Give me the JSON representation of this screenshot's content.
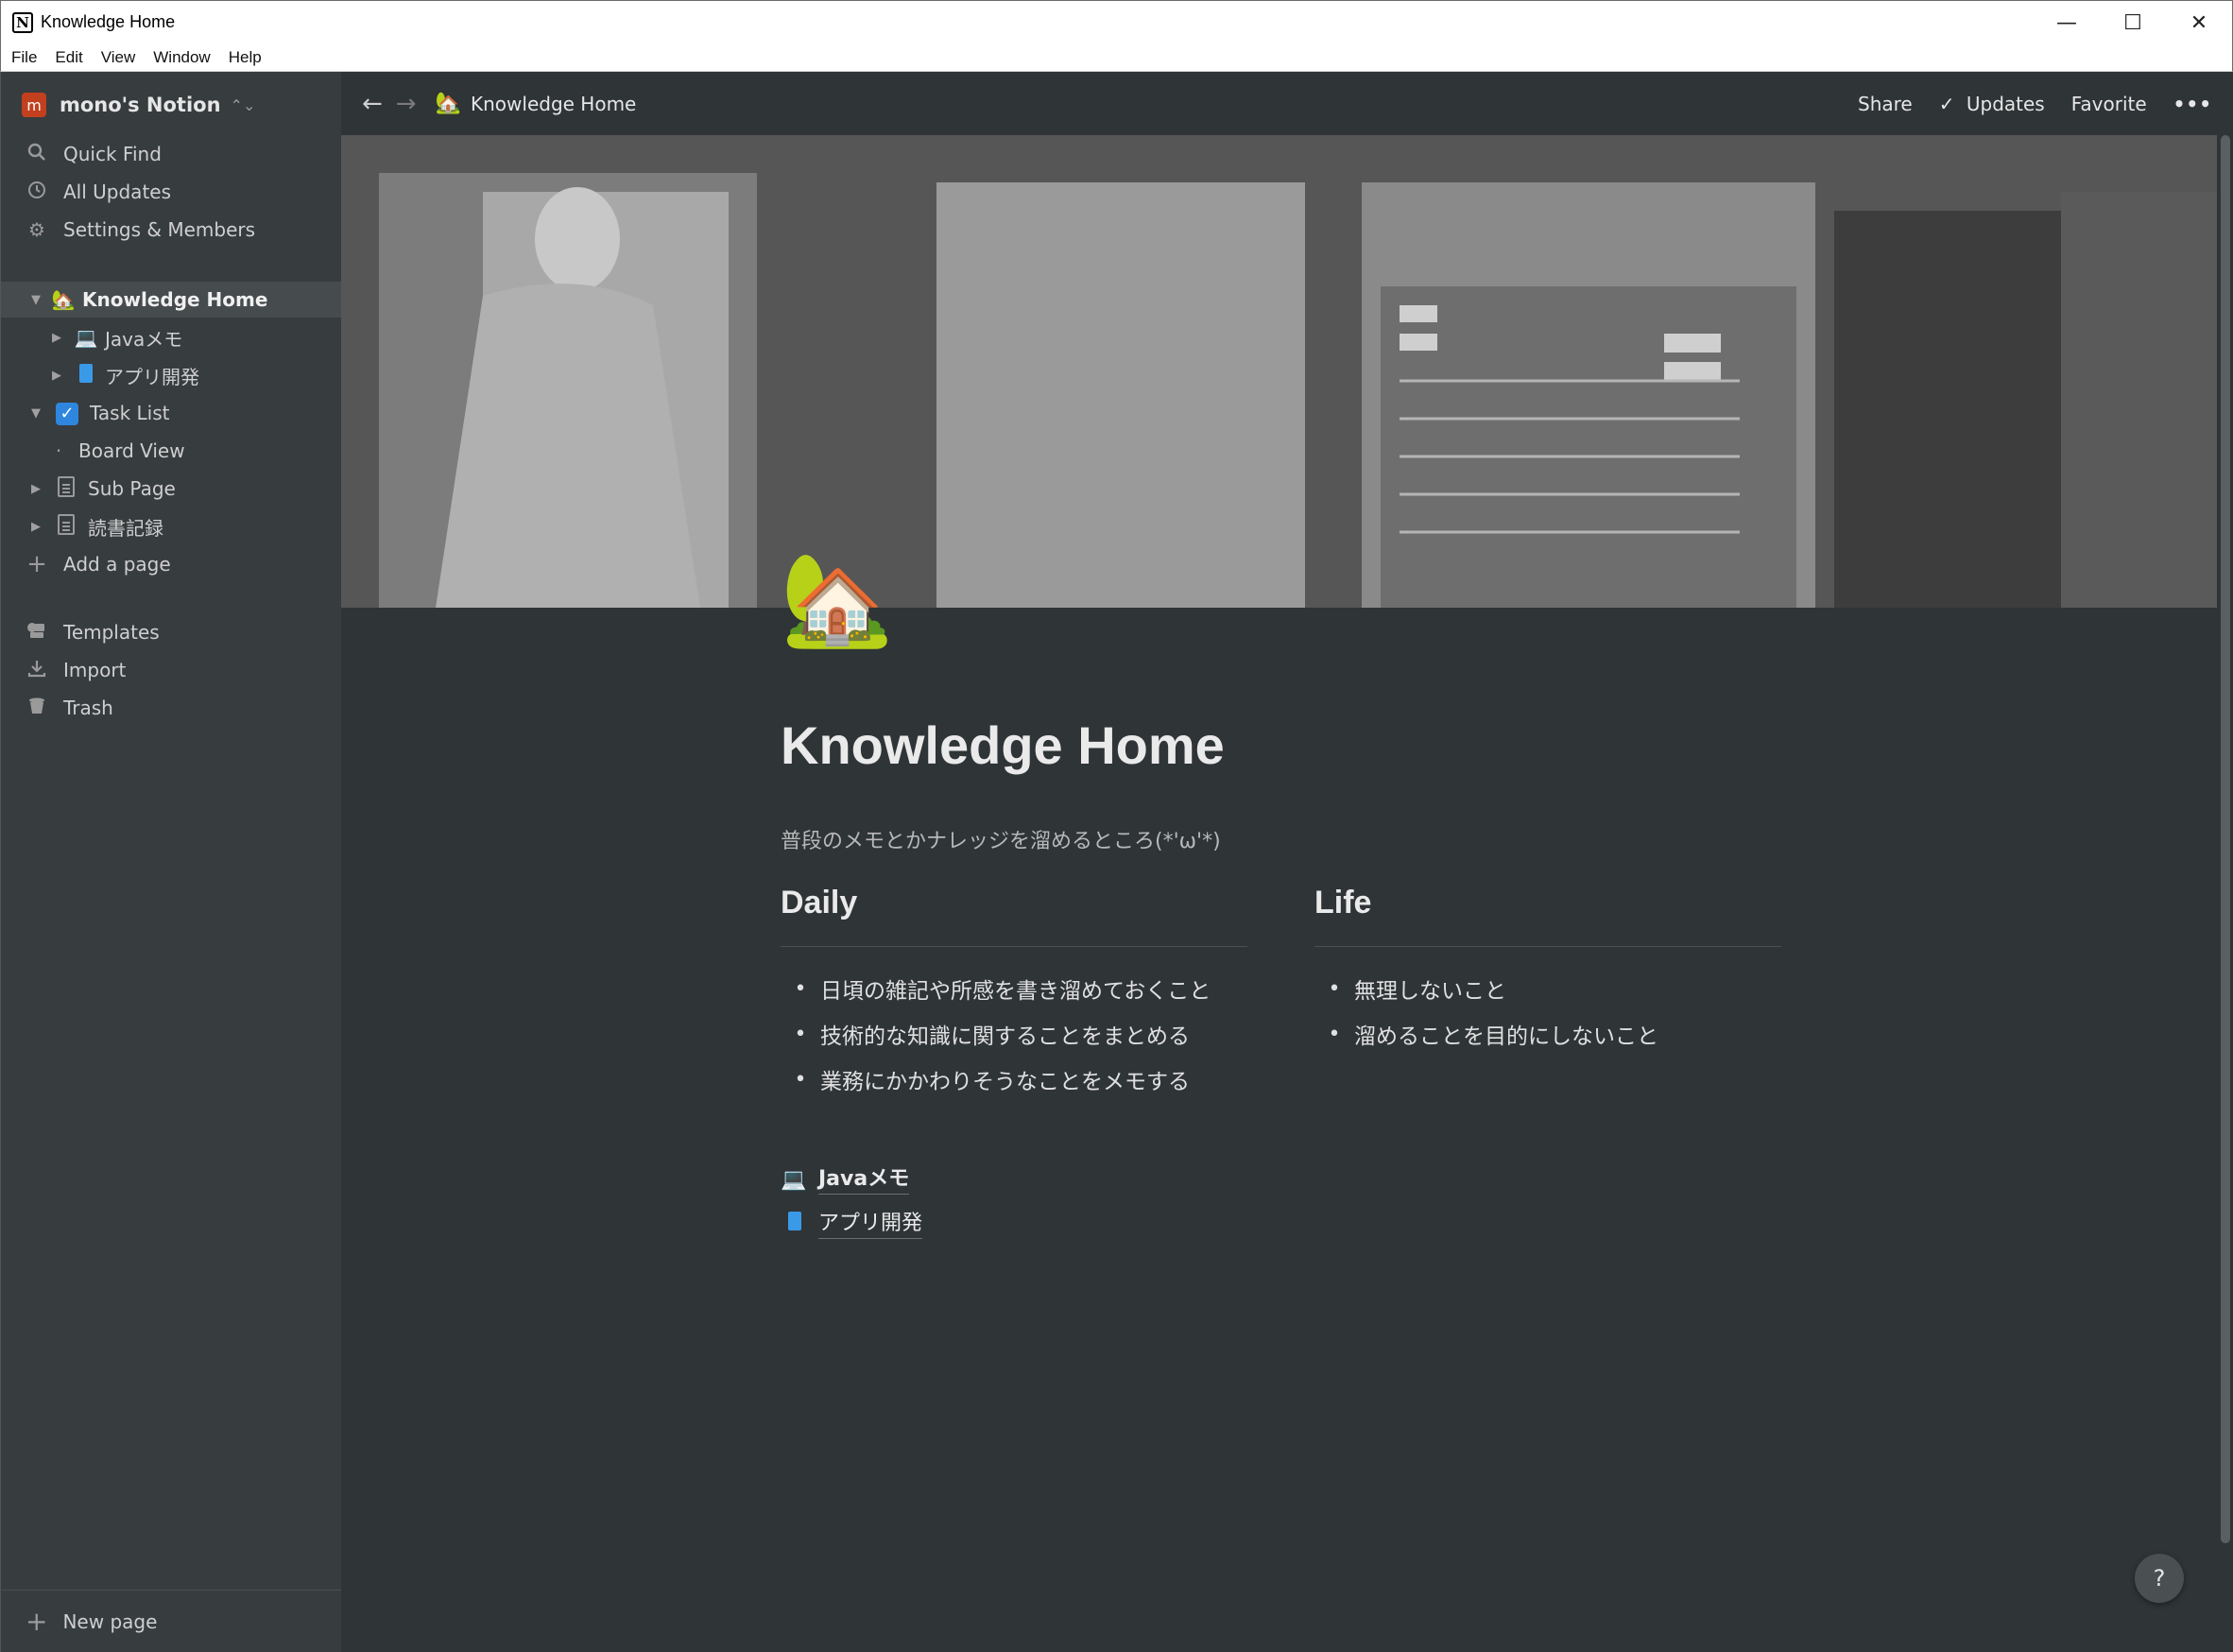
{
  "window": {
    "title": "Knowledge Home",
    "app_glyph": "N",
    "controls": {
      "minimize": "—",
      "maximize": "☐",
      "close": "✕"
    }
  },
  "menu": [
    "File",
    "Edit",
    "View",
    "Window",
    "Help"
  ],
  "sidebar": {
    "workspace": {
      "avatar": "m",
      "name": "mono's Notion",
      "chevron": "⌃⌄"
    },
    "nav": [
      {
        "label": "Quick Find",
        "icon": "search-icon"
      },
      {
        "label": "All Updates",
        "icon": "clock-icon"
      },
      {
        "label": "Settings & Members",
        "icon": "gear-icon"
      }
    ],
    "pages": [
      {
        "label": "Knowledge Home",
        "emoji": "🏡",
        "toggle": "▼",
        "active": true
      },
      {
        "label": "Javaメモ",
        "emoji": "💻",
        "toggle": "▶"
      },
      {
        "label": "アプリ開発",
        "emoji": "📘",
        "toggle": "▶"
      },
      {
        "label": "Task List",
        "emoji": "✓",
        "toggle": "▼"
      },
      {
        "label": "Board View",
        "bullet": "·"
      },
      {
        "label": "Sub Page",
        "toggle": "▶"
      },
      {
        "label": "読書記録",
        "toggle": "▶"
      }
    ],
    "add_page": "Add a page",
    "footer_nav": [
      {
        "label": "Templates",
        "icon": "templates-icon"
      },
      {
        "label": "Import",
        "icon": "import-icon"
      },
      {
        "label": "Trash",
        "icon": "trash-icon"
      }
    ],
    "new_page": "New page"
  },
  "topbar": {
    "back": "←",
    "forward": "→",
    "breadcrumb_emoji": "🏡",
    "breadcrumb": "Knowledge Home",
    "share": "Share",
    "updates": "Updates",
    "updates_check": "✓",
    "favorite": "Favorite",
    "more": "•••"
  },
  "page": {
    "icon": "🏡",
    "title": "Knowledge Home",
    "subtitle": "普段のメモとかナレッジを溜めるところ(*'ω'*)",
    "columns": [
      {
        "heading": "Daily",
        "items": [
          "日頃の雑記や所感を書き溜めておくこと",
          "技術的な知識に関することをまとめる",
          "業務にかかわりそうなことをメモする"
        ]
      },
      {
        "heading": "Life",
        "items": [
          "無理しないこと",
          "溜めることを目的にしないこと"
        ]
      }
    ],
    "links": [
      {
        "emoji": "💻",
        "label": "Javaメモ"
      },
      {
        "emoji": "📘",
        "label": "アプリ開発"
      }
    ]
  },
  "help": "?"
}
